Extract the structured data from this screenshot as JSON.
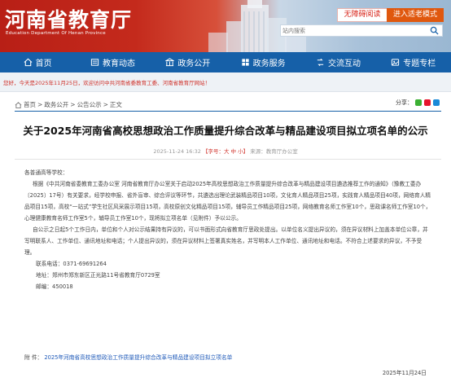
{
  "header": {
    "site_title": "河南省教育厅",
    "site_subtitle": "Education Department Of Henan Province",
    "accessibility_label": "无障碍阅读",
    "elder_mode_label": "进入适老模式",
    "search_placeholder": "站内搜索"
  },
  "nav": [
    {
      "label": "首页",
      "icon": "home-icon"
    },
    {
      "label": "教育动态",
      "icon": "news-icon"
    },
    {
      "label": "政务公开",
      "icon": "government-icon"
    },
    {
      "label": "政务服务",
      "icon": "service-icon"
    },
    {
      "label": "交流互动",
      "icon": "interaction-icon"
    },
    {
      "label": "专题专栏",
      "icon": "topic-icon"
    }
  ],
  "notice": "您好，今天是2025年11月25日，欢迎访问中共河南省委教育工委、河南省教育厅网站！",
  "breadcrumb": [
    "首页",
    "政务公开",
    "公告公示",
    "正文"
  ],
  "share_label": "分享：",
  "article": {
    "title": "关于2025年河南省高校思想政治工作质量提升综合改革与精品建设项目拟立项名单的公示",
    "date": "2025-11-24 16:32",
    "font_size_label": "【字号：大 中 小】",
    "source": "来源：教育厅办公室",
    "greeting": "各普通高等学校：",
    "paragraph_1": "根据《中共河南省委教育工委办公室 河南省教育厅办公室关于启动2025年高校思想政治工作质量提升综合改革与精品建设项目遴选推荐工作的通知》（豫教工委办〔2025〕17号）有关要求，经学校申报、省外盲审、综合评议等环节，共遴选出理论武装精品项目10项，文化育人精品项目25项，实践育人精品项目40项，网络育人精品项目15项，高校“一站式”学生社区风采展示项目15项，高校原创文化精品项目15项，辅导员工作精品项目25项，网络教育名师工作室10个，思政课名师工作室10个，心理健康教育名师工作室5个，辅导员工作室10个，现将拟立项名单（见附件）予以公示。",
    "paragraph_2": "自公示之日起5个工作日内，单位和个人对公示结果持有异议的，可以书面形式向省教育厅思政处提出。以单位名义提出异议的，须在异议材料上加盖本单位公章，并写明联系人、工作单位、通讯地址和电话；个人提出异议的，须在异议材料上签署真实姓名，并写明本人工作单位、通讯地址和电话。不符合上述要求的异议，不予受理。",
    "contact_phone": "联系电话：0371-69691264",
    "contact_address": "地址：郑州市郑东新区正光路11号省教育厅0729室",
    "contact_postcode": "邮编：450018",
    "attachment_prefix": "附  件：",
    "attachment_link": "2025年河南省高校思想政治工作质量提升综合改革与精品建设项目拟立项名单",
    "sign_date": "2025年11月24日"
  },
  "colors": {
    "nav_blue": "#1660a8",
    "brand_red": "#c42a1c",
    "alert_red": "#d0312a",
    "link_blue": "#1d58b8",
    "orange": "#e0580e"
  }
}
